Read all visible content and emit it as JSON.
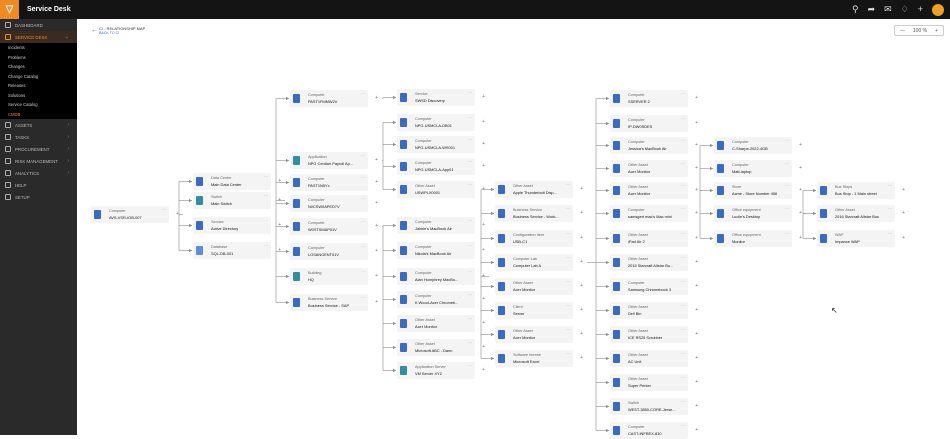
{
  "app": {
    "title": "Service Desk",
    "logo_glyph": "▽"
  },
  "topbar": {
    "icons": [
      "search-icon",
      "share-icon",
      "chat-icon",
      "bell-icon",
      "plus-icon"
    ]
  },
  "sidebar": {
    "items": [
      {
        "label": "DASHBOARD",
        "icon": "dashboard-icon",
        "active": false
      },
      {
        "label": "SERVICE DESK",
        "icon": "service-desk-icon",
        "active": true,
        "expanded": true
      }
    ],
    "sub_items": [
      {
        "label": "Incidents",
        "selected": false
      },
      {
        "label": "Problems",
        "selected": false
      },
      {
        "label": "Changes",
        "selected": false
      },
      {
        "label": "Change Catalog",
        "selected": false
      },
      {
        "label": "Releases",
        "selected": false
      },
      {
        "label": "Solutions",
        "selected": false
      },
      {
        "label": "Service Catalog",
        "selected": false
      },
      {
        "label": "CMDB",
        "selected": true
      }
    ],
    "items_after": [
      {
        "label": "ASSETS",
        "icon": "assets-icon"
      },
      {
        "label": "TASKS",
        "icon": "tasks-icon"
      },
      {
        "label": "PROCUREMENT",
        "icon": "procurement-icon"
      },
      {
        "label": "RISK MANAGEMENT",
        "icon": "risk-icon"
      },
      {
        "label": "ANALYTICS",
        "icon": "analytics-icon"
      },
      {
        "label": "HELP",
        "icon": "help-icon"
      },
      {
        "label": "SETUP",
        "icon": "setup-icon"
      }
    ]
  },
  "header": {
    "crumb_title": "CI - RELATIONSHIP MAP",
    "crumb_sub": "BACK TO CI"
  },
  "zoom": {
    "minus": "—",
    "value": "100 %",
    "plus": "+"
  },
  "nodes": [
    {
      "id": "root",
      "type": "Computer",
      "name": "AVS-VSR-IOB-007",
      "color": "blue"
    },
    {
      "id": "dc",
      "type": "Data Center",
      "name": "Main Data Center",
      "color": "blue"
    },
    {
      "id": "sw",
      "type": "Switch",
      "name": "Main Switch",
      "color": "teal"
    },
    {
      "id": "svc",
      "type": "Service",
      "name": "Active Directory",
      "color": "blue"
    },
    {
      "id": "db",
      "type": "Database",
      "name": "SQL-DB-001",
      "color": "lblue"
    },
    {
      "id": "c1",
      "type": "Computer",
      "name": "PAST1FMMW2V",
      "color": "blue"
    },
    {
      "id": "app",
      "type": "Application",
      "name": "NPG Cerdian Payroll Ap...",
      "color": "teal"
    },
    {
      "id": "c2",
      "type": "Computer",
      "name": "PAST1N5Yx",
      "color": "blue"
    },
    {
      "id": "c3",
      "type": "Computer",
      "name": "N0CSW0APED7V",
      "color": "blue"
    },
    {
      "id": "c4",
      "type": "Computer",
      "name": "W0STSMAP01V",
      "color": "blue"
    },
    {
      "id": "c5",
      "type": "Computer",
      "name": "LOSANGENT01V",
      "color": "blue"
    },
    {
      "id": "bld",
      "type": "Building",
      "name": "HQ",
      "color": "teal"
    },
    {
      "id": "bsap",
      "type": "Business Service",
      "name": "Business Service - SAP",
      "color": "blue"
    },
    {
      "id": "s1",
      "type": "Service",
      "name": "SWSD Discovery",
      "color": "blue"
    },
    {
      "id": "c6",
      "type": "Computer",
      "name": "NPG-USMCLA-DB01",
      "color": "blue"
    },
    {
      "id": "c7",
      "type": "Computer",
      "name": "NPG-USMCLA-WS001",
      "color": "blue"
    },
    {
      "id": "c8",
      "type": "Computer",
      "name": "NPG-USMCLA-App01",
      "color": "blue"
    },
    {
      "id": "oa1",
      "type": "Other Asset",
      "name": "USWPLX0001",
      "color": "blue"
    },
    {
      "id": "c9",
      "type": "Computer",
      "name": "Jaimie's MacBook Air",
      "color": "blue"
    },
    {
      "id": "c10",
      "type": "Computer",
      "name": "Nikola's MacBook Air",
      "color": "blue"
    },
    {
      "id": "c11",
      "type": "Computer",
      "name": "Alan Humphrey MacBo...",
      "color": "blue"
    },
    {
      "id": "c12",
      "type": "Computer",
      "name": "K.Wood-Acer Chromeb...",
      "color": "blue"
    },
    {
      "id": "oa2",
      "type": "Other Asset",
      "name": "Acer Monitor",
      "color": "blue"
    },
    {
      "id": "oa3",
      "type": "Other Asset",
      "name": "Microsoft ABC - Dann",
      "color": "blue"
    },
    {
      "id": "as1",
      "type": "Application Server",
      "name": "VM Server XYZ",
      "color": "teal"
    },
    {
      "id": "oa4",
      "type": "Other Asset",
      "name": "Apple Thunderbolt Disp...",
      "color": "blue"
    },
    {
      "id": "bs2",
      "type": "Business Service",
      "name": "Business Service - Work...",
      "color": "blue"
    },
    {
      "id": "ci1",
      "type": "Configuration Item",
      "name": "USB-C1",
      "color": "blue"
    },
    {
      "id": "lab",
      "type": "Computer Lab",
      "name": "Computer Lab A",
      "color": "blue"
    },
    {
      "id": "oa5",
      "type": "Other Asset",
      "name": "Acer Monitor",
      "color": "blue"
    },
    {
      "id": "cl1",
      "type": "Client",
      "name": "Server",
      "color": "blue"
    },
    {
      "id": "oa6",
      "type": "Other Asset",
      "name": "Acer Monitor",
      "color": "blue"
    },
    {
      "id": "sl1",
      "type": "Software license",
      "name": "Microsoft Excel",
      "color": "blue"
    },
    {
      "id": "d1",
      "type": "Computer",
      "name": "SSERVER 2",
      "color": "blue"
    },
    {
      "id": "d2",
      "type": "Computer",
      "name": "IP-DW0SDES",
      "color": "blue"
    },
    {
      "id": "d3",
      "type": "Computer",
      "name": "Jessica's MacBook Air",
      "color": "blue"
    },
    {
      "id": "d4",
      "type": "Other Asset",
      "name": "Acer Monitor",
      "color": "blue"
    },
    {
      "id": "d5",
      "type": "Other Asset",
      "name": "Acer Monitor",
      "color": "blue"
    },
    {
      "id": "d6",
      "type": "Computer",
      "name": "samsgert mac's Mac mini",
      "color": "blue"
    },
    {
      "id": "d7",
      "type": "Other Asset",
      "name": "iPad Air 2",
      "color": "blue"
    },
    {
      "id": "d8",
      "type": "Other Asset",
      "name": "2015 Starcraft Allstar Bu...",
      "color": "blue"
    },
    {
      "id": "d9",
      "type": "Computer",
      "name": "Samsung Chromebook 3",
      "color": "blue"
    },
    {
      "id": "d10",
      "type": "Other Asset",
      "name": "Dell Bin",
      "color": "blue"
    },
    {
      "id": "d11",
      "type": "Other Asset",
      "name": "ICE RS25 Scrubber",
      "color": "blue"
    },
    {
      "id": "d12",
      "type": "Other Asset",
      "name": "AC Unit",
      "color": "blue"
    },
    {
      "id": "d13",
      "type": "Other Asset",
      "name": "Super Printer",
      "color": "blue"
    },
    {
      "id": "d14",
      "type": "Switch",
      "name": "WEST-3850-CORE-Jerse...",
      "color": "blue"
    },
    {
      "id": "d15",
      "type": "Computer",
      "name": "CAST-INFREX-830",
      "color": "blue"
    },
    {
      "id": "e1",
      "type": "Computer",
      "name": "C-Sharpe-2022-4GB",
      "color": "blue"
    },
    {
      "id": "e2",
      "type": "Computer",
      "name": "Matt-laptop",
      "color": "blue"
    },
    {
      "id": "e3",
      "type": "Store",
      "name": "Acme - Store Number 456",
      "color": "blue"
    },
    {
      "id": "e4",
      "type": "Office equipment",
      "name": "Lucile's Desktop",
      "color": "blue"
    },
    {
      "id": "e5",
      "type": "Office equipment",
      "name": "Monitor",
      "color": "blue"
    },
    {
      "id": "f1",
      "type": "Bus Stops",
      "name": "Bus Stop - 1 Main street",
      "color": "blue"
    },
    {
      "id": "f2",
      "type": "Other Asset",
      "name": "2016 Starcraft Allstar Bus",
      "color": "blue"
    },
    {
      "id": "f3",
      "type": "WAP",
      "name": "Impance WAP",
      "color": "blue"
    }
  ],
  "ui": {
    "menu_glyph": "···",
    "expand_glyph": "+",
    "back_glyph": "←",
    "cursor_glyph": "↖"
  }
}
